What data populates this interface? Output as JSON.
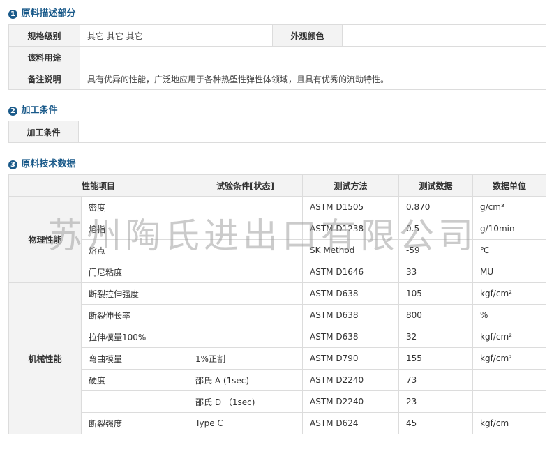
{
  "section1": {
    "num": "1",
    "title": "原料描述部分",
    "rows": {
      "spec_label": "规格级别",
      "spec_value": "其它 其它 其它",
      "color_label": "外观颜色",
      "color_value": "",
      "use_label": "该料用途",
      "use_value": "",
      "note_label": "备注说明",
      "note_value": "具有优异的性能，广泛地应用于各种热塑性弹性体领域，且具有优秀的流动特性。"
    }
  },
  "section2": {
    "num": "2",
    "title": "加工条件",
    "label": "加工条件",
    "value": ""
  },
  "section3": {
    "num": "3",
    "title": "原料技术数据",
    "headers": [
      "性能项目",
      "试验条件[状态]",
      "测试方法",
      "测试数据",
      "数据单位"
    ],
    "group_physical": "物理性能",
    "group_mechanical": "机械性能",
    "rows": [
      {
        "item": "密度",
        "cond": "",
        "method": "ASTM D1505",
        "data": "0.870",
        "unit": "g/cm³"
      },
      {
        "item": "熔指",
        "cond": "",
        "method": "ASTM D1238",
        "data": "0.5",
        "unit": "g/10min"
      },
      {
        "item": "熔点",
        "cond": "",
        "method": "SK Method",
        "data": "-59",
        "unit": "℃"
      },
      {
        "item": "门尼粘度",
        "cond": "",
        "method": "ASTM D1646",
        "data": "33",
        "unit": "MU"
      },
      {
        "item": "断裂拉伸强度",
        "cond": "",
        "method": "ASTM D638",
        "data": "105",
        "unit": "kgf/cm²"
      },
      {
        "item": "断裂伸长率",
        "cond": "",
        "method": "ASTM D638",
        "data": "800",
        "unit": "%"
      },
      {
        "item": "拉伸模量100%",
        "cond": "",
        "method": "ASTM D638",
        "data": "32",
        "unit": "kgf/cm²"
      },
      {
        "item": "弯曲模量",
        "cond": "1%正割",
        "method": "ASTM D790",
        "data": "155",
        "unit": "kgf/cm²"
      },
      {
        "item": "硬度",
        "cond": "邵氏 A (1sec)",
        "method": "ASTM D2240",
        "data": "73",
        "unit": ""
      },
      {
        "item": "",
        "cond": "邵氏 D （1sec)",
        "method": "ASTM D2240",
        "data": "23",
        "unit": ""
      },
      {
        "item": "断裂强度",
        "cond": "Type C",
        "method": "ASTM D624",
        "data": "45",
        "unit": "kgf/cm"
      }
    ]
  },
  "watermark": "苏州陶氏进出口有限公司",
  "colors": {
    "accent": "#1a5a8a",
    "label_bg": "#f3f3f3",
    "border": "#dcdcdc"
  }
}
